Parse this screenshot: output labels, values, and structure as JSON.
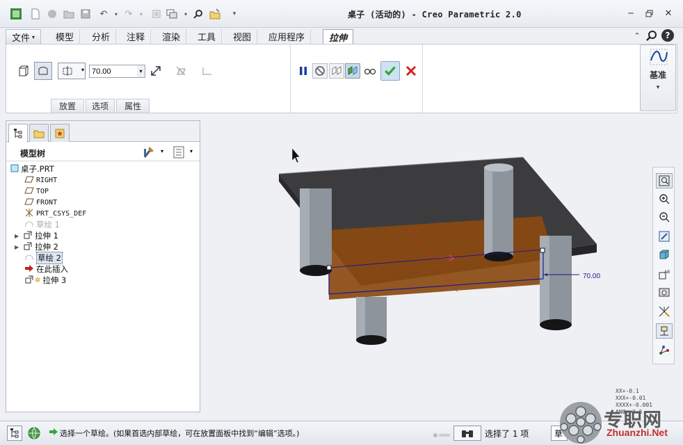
{
  "window": {
    "title": "桌子 (活动的) - Creo Parametric 2.0"
  },
  "ribbon": {
    "tabs": [
      "文件",
      "模型",
      "分析",
      "注释",
      "渲染",
      "工具",
      "视图",
      "应用程序",
      "拉伸"
    ],
    "file_arrow": "▾",
    "active_tab": "拉伸",
    "depth_value": "70.00",
    "sub_tabs": [
      "放置",
      "选项",
      "属性"
    ],
    "datum_label": "基准",
    "datum_arrow": "▾"
  },
  "model_tree": {
    "title": "模型树",
    "nodes": [
      {
        "label": "桌子.PRT",
        "icon": "part-icon"
      },
      {
        "label": "RIGHT",
        "icon": "datum-plane-icon"
      },
      {
        "label": "TOP",
        "icon": "datum-plane-icon"
      },
      {
        "label": "FRONT",
        "icon": "datum-plane-icon"
      },
      {
        "label": "PRT_CSYS_DEF",
        "icon": "csys-icon"
      },
      {
        "label": "草绘 1",
        "icon": "sketch-icon"
      },
      {
        "label": "拉伸 1",
        "icon": "extrude-icon"
      },
      {
        "label": "拉伸 2",
        "icon": "extrude-icon"
      },
      {
        "label": "草绘 2",
        "icon": "sketch-icon"
      },
      {
        "label": "在此插入",
        "icon": "insert-arrow-icon"
      },
      {
        "label": "拉伸 3",
        "icon": "extrude-icon"
      }
    ]
  },
  "graphics": {
    "dimension_label": "70.00",
    "tolerances": [
      "XX+-0.1",
      "XXX+-0.01",
      "XXXX+-0.001",
      "ANG+-0.5"
    ]
  },
  "status": {
    "message": "选择一个草绘。(如果首选内部草绘，可在放置面板中找到“编辑”选项。)",
    "selected": "选择了 1 项",
    "filter_label": "草"
  },
  "watermark": {
    "cn": "专职网",
    "en": "Zhuanzhi.Net"
  },
  "colors": {
    "accent_green": "#2fa83c",
    "cancel_red": "#d42020",
    "sketch_plane": "#8a4a10",
    "table_top": "#3c3c3e"
  }
}
